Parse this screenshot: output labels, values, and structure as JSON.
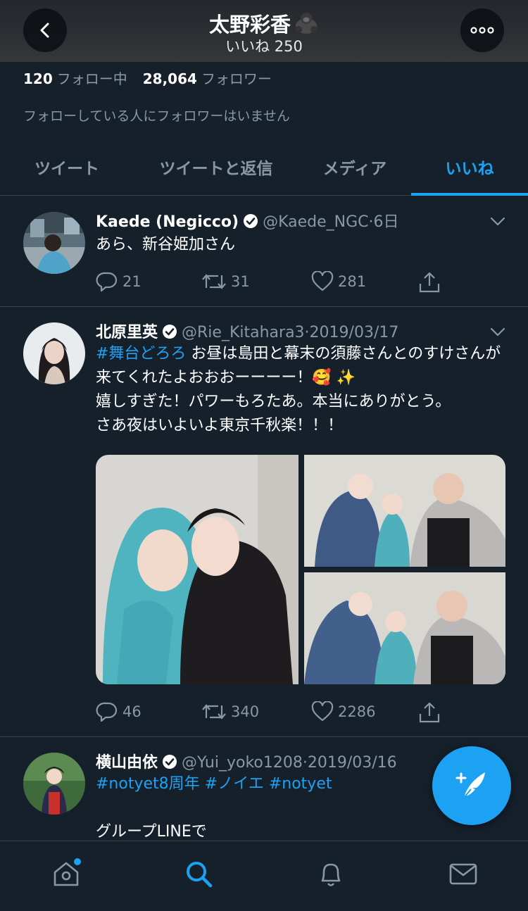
{
  "header": {
    "title": "太野彩香",
    "subtitle": "いいね 250",
    "title_icon": "gorilla-emoji"
  },
  "profile": {
    "following_count": "120",
    "following_label": "フォロー中",
    "followers_count": "28,064",
    "followers_label": "フォロワー",
    "mutual_note": "フォローしている人にフォロワーはいません"
  },
  "tabs": [
    {
      "label": "ツイート",
      "active": false
    },
    {
      "label": "ツイートと返信",
      "active": false
    },
    {
      "label": "メディア",
      "active": false
    },
    {
      "label": "いいね",
      "active": true
    }
  ],
  "tweets": [
    {
      "name": "Kaede (Negicco)",
      "handle": "@Kaede_NGC",
      "sep": "·",
      "time": "6日",
      "text": "あら、新谷姫加さん",
      "replies": "21",
      "retweets": "31",
      "likes": "281"
    },
    {
      "name": "北原里英",
      "handle": "@Rie_Kitahara3",
      "sep": "·",
      "time": "2019/03/17",
      "hashtag": "#舞台どろろ",
      "text_line1": " お昼は島田と幕末の須藤さんとのすけさんが来てくれたよおおおーーーー！🥰 ✨",
      "text_line2": "嬉しすぎた！パワーもろたあ。本当にありがとう。",
      "text_line3": "さあ夜はいよいよ東京千秋楽！！！",
      "replies": "46",
      "retweets": "340",
      "likes": "2286"
    },
    {
      "name": "横山由依",
      "handle": "@Yui_yoko1208",
      "sep": "·",
      "time": "2019/03/16",
      "hashtags": "#notyet8周年 #ノイエ #notyet",
      "text": "グループLINEで"
    }
  ],
  "colors": {
    "background": "#15202b",
    "accent": "#1da1f2",
    "secondary_text": "#8899a6",
    "divider": "#38444d"
  }
}
